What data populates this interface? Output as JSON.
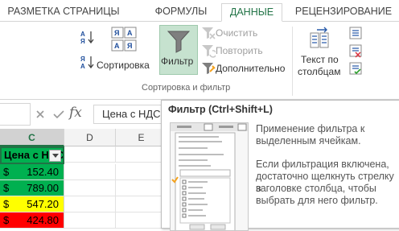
{
  "tabs": [
    {
      "label": "РАЗМЕТКА СТРАНИЦЫ"
    },
    {
      "label": "ФОРМУЛЫ"
    },
    {
      "label": "ДАННЫЕ"
    },
    {
      "label": "РЕЦЕНЗИРОВАНИЕ"
    }
  ],
  "ribbon": {
    "sort_label": "Сортировка",
    "filter_label": "Фильтр",
    "clear_label": "Очистить",
    "reapply_label": "Повторить",
    "advanced_label": "Дополнительно",
    "group_label": "Сортировка и фильтр",
    "text_to_columns_line1": "Текст по",
    "text_to_columns_line2": "столбцам"
  },
  "formula_bar": {
    "fx_glyph": "fx",
    "content": "Цена с НДС"
  },
  "grid": {
    "columns": [
      "C",
      "D",
      "E"
    ],
    "header_cell": "Цена с НДС",
    "rows": [
      {
        "currency": "$",
        "value": "152.40",
        "color": "#00b050"
      },
      {
        "currency": "$",
        "value": "789.00",
        "color": "#00b050"
      },
      {
        "currency": "$",
        "value": "547.20",
        "color": "#ffff00"
      },
      {
        "currency": "$",
        "value": "424.80",
        "color": "#ff0000"
      }
    ]
  },
  "tooltip": {
    "title": "Фильтр (Ctrl+Shift+L)",
    "para1_line1": "Применение фильтра к",
    "para1_line2": "выделенным ячейкам.",
    "para2_line1": "Если фильтрация включена,",
    "para2_line2": "достаточно щелкнуть стрелку в",
    "para2_line3": "заголовке столбца, чтобы",
    "para2_line4": "выбрать для него фильтр."
  },
  "colors": {
    "accent": "#217346",
    "filter_active_bg": "#c6e2cf",
    "header_cell_bg": "#00b050"
  }
}
